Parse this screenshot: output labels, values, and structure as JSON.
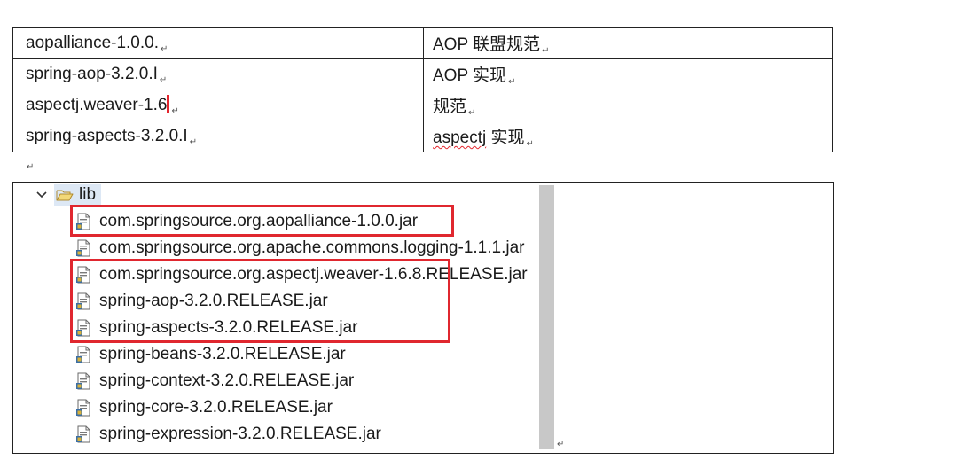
{
  "table": {
    "rows": [
      {
        "name": "aopalliance-1.0.0.",
        "desc": "AOP 联盟规范"
      },
      {
        "name": "spring-aop-3.2.0.I",
        "desc": "AOP 实现"
      },
      {
        "name": "aspectj.weaver-1.6",
        "desc": "规范"
      },
      {
        "name": " spring-aspects-3.2.0.I",
        "desc_prefix": "aspectj",
        "desc": " 实现"
      }
    ],
    "para_mark": "↵"
  },
  "tree": {
    "folder": {
      "label": "lib",
      "expanded": true
    },
    "items": [
      {
        "label": "com.springsource.org.aopalliance-1.0.0.jar"
      },
      {
        "label": "com.springsource.org.apache.commons.logging-1.1.1.jar"
      },
      {
        "label": "com.springsource.org.aspectj.weaver-1.6.8.RELEASE.jar"
      },
      {
        "label": "spring-aop-3.2.0.RELEASE.jar"
      },
      {
        "label": "spring-aspects-3.2.0.RELEASE.jar"
      },
      {
        "label": "spring-beans-3.2.0.RELEASE.jar"
      },
      {
        "label": "spring-context-3.2.0.RELEASE.jar"
      },
      {
        "label": "spring-core-3.2.0.RELEASE.jar"
      },
      {
        "label": "spring-expression-3.2.0.RELEASE.jar"
      }
    ],
    "highlight_color": "#e0272f"
  },
  "icons": {
    "folder": "folder-open-icon",
    "jar": "jar-file-icon",
    "chevron": "chevron-down-icon"
  }
}
